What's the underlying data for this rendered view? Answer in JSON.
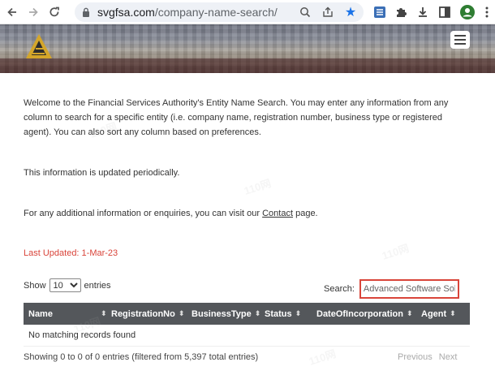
{
  "browser": {
    "url_domain": "svgfsa.com",
    "url_path": "/company-name-search/"
  },
  "intro": {
    "paragraph1": "Welcome to the Financial Services Authority's Entity Name Search. You may enter any information from any column to search for a specific entity (i.e. company name, registration number, business type or registered agent). You can also sort any column based on preferences.",
    "paragraph2": "This information is updated periodically.",
    "paragraph3_prefix": "For any additional information or enquiries, you can visit our ",
    "paragraph3_link": "Contact",
    "paragraph3_suffix": " page.",
    "last_updated": "Last Updated:  1-Mar-23"
  },
  "controls": {
    "show_label": "Show",
    "show_value": "10",
    "entries_label": "entries",
    "search_label": "Search:",
    "search_value": "Advanced Software Solu"
  },
  "table": {
    "columns": [
      "Name",
      "RegistrationNo",
      "BusinessType",
      "Status",
      "DateOfIncorporation",
      "Agent"
    ],
    "empty_message": "No matching records found",
    "sort_glyph": "⬍"
  },
  "footer": {
    "info": "Showing 0 to 0 of 0 entries (filtered from 5,397 total entries)",
    "previous": "Previous",
    "next": "Next"
  },
  "watermark": "110网",
  "colors": {
    "accent_red": "#d9443a",
    "table_header": "#54575b",
    "chrome_blue": "#1a73e8"
  }
}
